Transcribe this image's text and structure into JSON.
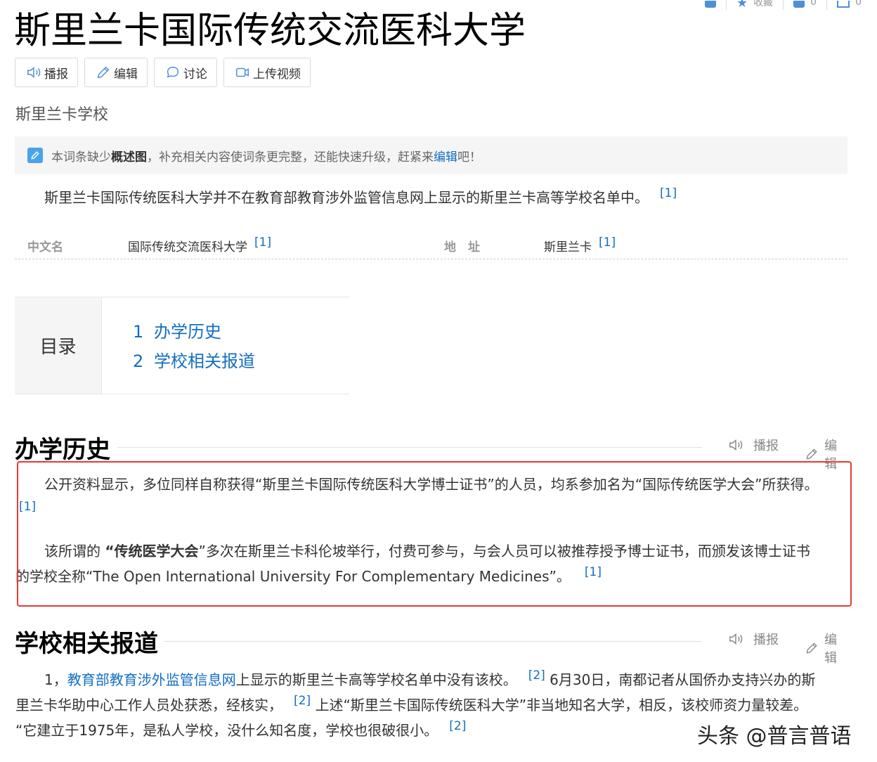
{
  "top_strip": {
    "fav_label": "收藏",
    "fav_count": "0",
    "share_count": "0"
  },
  "title": "斯里兰卡国际传统交流医科大学",
  "toolbar": [
    {
      "icon": "speaker-icon",
      "label": "播报"
    },
    {
      "icon": "pencil-icon",
      "label": "编辑"
    },
    {
      "icon": "chat-icon",
      "label": "讨论"
    },
    {
      "icon": "video-icon",
      "label": "上传视频"
    }
  ],
  "subtitle": "斯里兰卡学校",
  "notice": {
    "prefix": "本词条缺少",
    "bold": "概述图",
    "middle": "，补充相关内容使词条更完整，还能快速升级，赶紧来",
    "link": "编辑",
    "suffix": "吧！"
  },
  "intro": {
    "text": "斯里兰卡国际传统医科大学并不在教育部教育涉外监管信息网上显示的斯里兰卡高等学校名单中。",
    "ref": "[1]"
  },
  "infobox": [
    {
      "key": "中文名",
      "value": "国际传统交流医科大学",
      "ref": "[1]"
    },
    {
      "key": "地　址",
      "value": "斯里兰卡",
      "ref": "[1]"
    }
  ],
  "toc": {
    "label": "目录",
    "items": [
      {
        "num": "1",
        "text": "办学历史"
      },
      {
        "num": "2",
        "text": "学校相关报道"
      }
    ]
  },
  "section_tools": {
    "read": "播报",
    "edit": "编辑"
  },
  "section1": {
    "heading": "办学历史",
    "p1_text": "公开资料显示，多位同样自称获得“斯里兰卡国际传统医科大学博士证书”的人员，均系参加名为“国际传统医学大会”所获得。",
    "p1_ref": "[1]",
    "p2_pre": "该所谓的 ",
    "p2_bold": "“传统医学大会",
    "p2_line1_rest": "”多次在斯里兰卡科伦坡举行，付费可参与，与会人员可以被推荐授予博士证书，而颁发该博士证书",
    "p2_line2": "的学校全称“The Open International University For Complementary Medicines”。",
    "p2_ref": "[1]"
  },
  "section2": {
    "heading": "学校相关报道",
    "l1_pre": "1，",
    "l1_link": "教育部教育涉外监管信息网",
    "l1_rest": "上显示的斯里兰卡高等学校名单中没有该校。",
    "l1_ref": "[2]",
    "l1_tail": " 6月30日，南都记者从国侨办支持兴办的斯",
    "l2_text": "里兰卡华助中心工作人员处获悉，经核实，",
    "l2_ref": "[2]",
    "l2_tail": " 上述“斯里兰卡国际传统医科大学”非当地知名大学，相反，该校师资力量较差。",
    "l3_text": "“它建立于1975年，是私人学校，没什么知名度，学校也很破很小。",
    "l3_ref": "[2]"
  },
  "watermark": "头条 @普言普语"
}
